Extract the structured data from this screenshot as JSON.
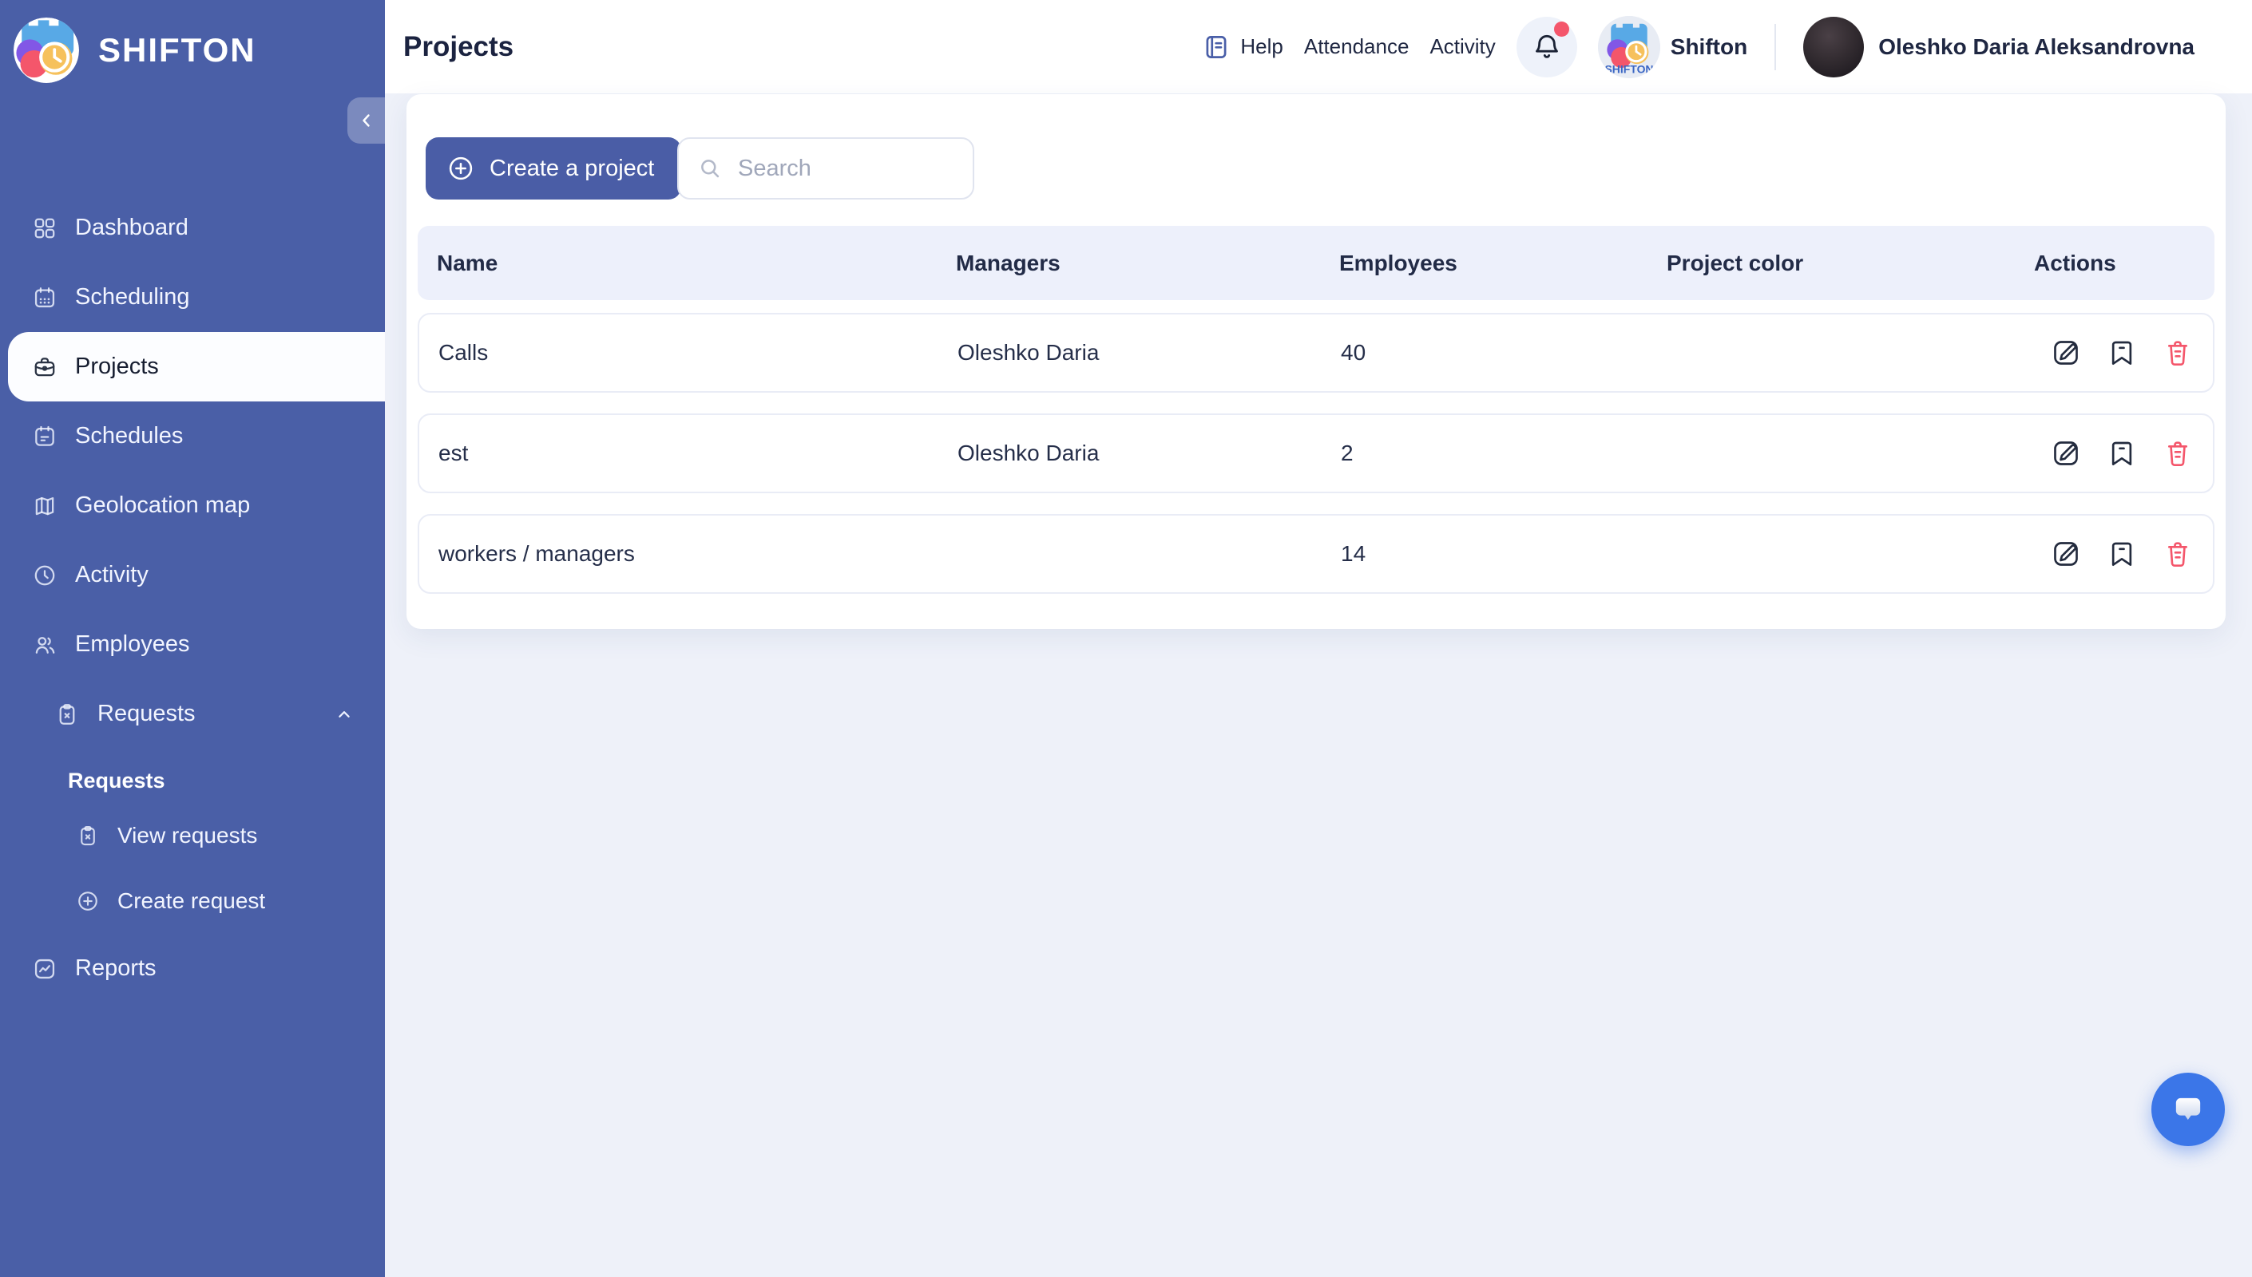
{
  "brand": "SHIFTON",
  "sidebar": {
    "items": [
      {
        "label": "Dashboard"
      },
      {
        "label": "Scheduling"
      },
      {
        "label": "Projects",
        "active": true
      },
      {
        "label": "Schedules"
      },
      {
        "label": "Geolocation map"
      },
      {
        "label": "Activity"
      },
      {
        "label": "Employees"
      }
    ],
    "requests": {
      "toggle_label": "Requests",
      "section_label": "Requests",
      "items": [
        {
          "label": "View requests"
        },
        {
          "label": "Create request"
        }
      ]
    },
    "reports": {
      "label": "Reports"
    }
  },
  "header": {
    "title": "Projects",
    "help": "Help",
    "links": [
      "Attendance",
      "Activity"
    ],
    "company": "Shifton",
    "user": "Oleshko Daria Aleksandrovna",
    "notifications_unread": true
  },
  "toolbar": {
    "create_button": "Create a project",
    "search_placeholder": "Search"
  },
  "table": {
    "columns": [
      "Name",
      "Managers",
      "Employees",
      "Project color",
      "Actions"
    ],
    "rows": [
      {
        "name": "Calls",
        "managers": "Oleshko Daria",
        "employees": "40",
        "color": "#7c22e8"
      },
      {
        "name": "est",
        "managers": "Oleshko Daria",
        "employees": "2",
        "color": "#7c22e8"
      },
      {
        "name": "workers / managers",
        "managers": "",
        "employees": "14",
        "color": "#7c22e8"
      }
    ]
  },
  "colors": {
    "sidebar": "#4a5fa7",
    "primary_button": "#4a5da6",
    "table_header_bg": "#edf0fb",
    "project_dot": "#7c22e8",
    "danger": "#f4566b",
    "chat_fab": "#3b76e8",
    "notification_dot": "#f4566b"
  }
}
